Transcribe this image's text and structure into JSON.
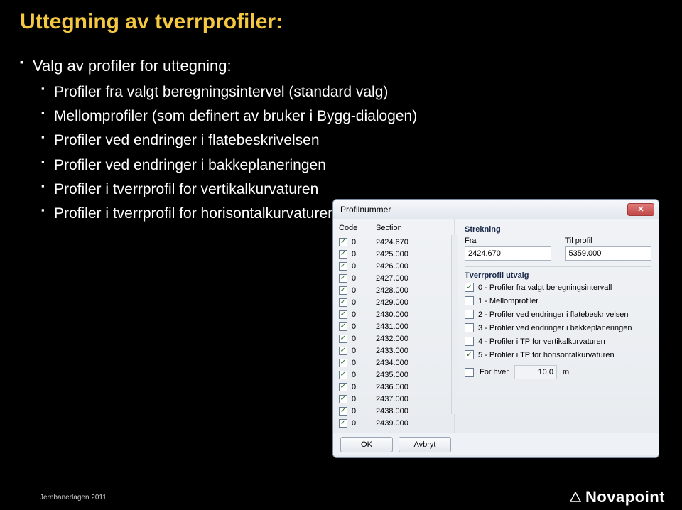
{
  "slide": {
    "title": "Uttegning av tverrprofiler:",
    "bullets": [
      {
        "text": "Valg av profiler for uttegning:",
        "children": [
          "Profiler fra valgt beregningsintervel (standard valg)",
          "Mellomprofiler (som definert av bruker i Bygg-dialogen)",
          "Profiler ved endringer i flatebeskrivelsen",
          "Profiler ved endringer i bakkeplaneringen",
          "Profiler i tverrprofil for vertikalkurvaturen",
          "Profiler i tverrprofil for horisontalkurvaturen"
        ]
      }
    ]
  },
  "dialog": {
    "title": "Profilnummer",
    "strekning_label": "Strekning",
    "fra_label": "Fra",
    "til_label": "Til profil",
    "fra_value": "2424.670",
    "til_value": "5359.000",
    "utvalg_label": "Tverrprofil utvalg",
    "columns": {
      "code": "Code",
      "section": "Section"
    },
    "rows": [
      {
        "checked": true,
        "code": "0",
        "section": "2424.670"
      },
      {
        "checked": true,
        "code": "0",
        "section": "2425.000"
      },
      {
        "checked": true,
        "code": "0",
        "section": "2426.000"
      },
      {
        "checked": true,
        "code": "0",
        "section": "2427.000"
      },
      {
        "checked": true,
        "code": "0",
        "section": "2428.000"
      },
      {
        "checked": true,
        "code": "0",
        "section": "2429.000"
      },
      {
        "checked": true,
        "code": "0",
        "section": "2430.000"
      },
      {
        "checked": true,
        "code": "0",
        "section": "2431.000"
      },
      {
        "checked": true,
        "code": "0",
        "section": "2432.000"
      },
      {
        "checked": true,
        "code": "0",
        "section": "2433.000"
      },
      {
        "checked": true,
        "code": "0",
        "section": "2434.000"
      },
      {
        "checked": true,
        "code": "0",
        "section": "2435.000"
      },
      {
        "checked": true,
        "code": "0",
        "section": "2436.000"
      },
      {
        "checked": true,
        "code": "0",
        "section": "2437.000"
      },
      {
        "checked": true,
        "code": "0",
        "section": "2438.000"
      },
      {
        "checked": true,
        "code": "0",
        "section": "2439.000"
      }
    ],
    "options": [
      {
        "checked": true,
        "label": "0 - Profiler fra valgt beregningsintervall"
      },
      {
        "checked": false,
        "label": "1 - Mellomprofiler"
      },
      {
        "checked": false,
        "label": "2 - Profiler ved endringer i flatebeskrivelsen"
      },
      {
        "checked": false,
        "label": "3 - Profiler ved endringer i bakkeplaneringen"
      },
      {
        "checked": false,
        "label": "4 - Profiler i TP for vertikalkurvaturen"
      },
      {
        "checked": true,
        "label": "5 - Profiler i TP for horisontalkurvaturen"
      }
    ],
    "forhver": {
      "label": "For hver",
      "value": "10,0",
      "unit": "m",
      "checked": false
    },
    "buttons": {
      "ok": "OK",
      "cancel": "Avbryt"
    }
  },
  "footer": {
    "note": "Jernbanedagen 2011",
    "brand": "Novapoint"
  }
}
